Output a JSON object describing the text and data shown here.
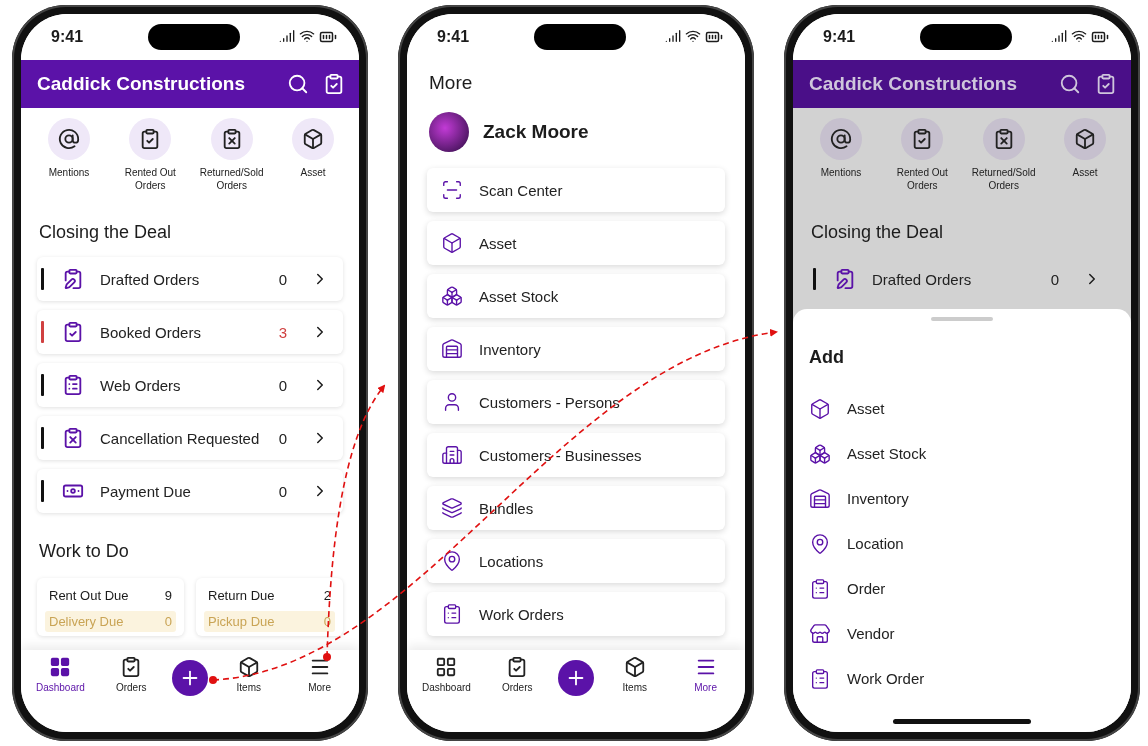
{
  "dashboard_screen": {
    "status_bar": {
      "time": "9:41"
    },
    "header": {
      "title": "Caddick Constructions"
    },
    "quick_links": [
      {
        "label": "Mentions"
      },
      {
        "label": "Rented Out Orders"
      },
      {
        "label": "Returned/Sold Orders"
      },
      {
        "label": "Asset"
      }
    ],
    "closing_the_deal": {
      "title": "Closing the Deal",
      "rows": [
        {
          "label": "Drafted Orders",
          "count": "0",
          "flagged": false
        },
        {
          "label": "Booked Orders",
          "count": "3",
          "flagged": true
        },
        {
          "label": "Web Orders",
          "count": "0",
          "flagged": false
        },
        {
          "label": "Cancellation Requested",
          "count": "0",
          "flagged": false
        },
        {
          "label": "Payment Due",
          "count": "0",
          "flagged": false
        }
      ]
    },
    "work_to_do": {
      "title": "Work to Do",
      "cards": [
        {
          "label": "Rent Out Due",
          "count": "9",
          "sub_label": "Delivery Due",
          "sub_count": "0"
        },
        {
          "label": "Return Due",
          "count": "2",
          "sub_label": "Pickup Due",
          "sub_count": "0"
        }
      ]
    },
    "tab_bar": [
      {
        "label": "Dashboard",
        "selected": true
      },
      {
        "label": "Orders",
        "selected": false
      },
      {
        "label": "Items",
        "selected": false
      },
      {
        "label": "More",
        "selected": false
      }
    ]
  },
  "more_screen": {
    "status_bar": {
      "time": "9:41"
    },
    "title": "More",
    "profile": {
      "name": "Zack Moore"
    },
    "menu": [
      {
        "label": "Scan Center"
      },
      {
        "label": "Asset"
      },
      {
        "label": "Asset Stock"
      },
      {
        "label": "Inventory"
      },
      {
        "label": "Customers - Persons"
      },
      {
        "label": "Customers - Businesses"
      },
      {
        "label": "Bundles"
      },
      {
        "label": "Locations"
      },
      {
        "label": "Work Orders"
      }
    ],
    "tab_bar": [
      {
        "label": "Dashboard",
        "selected": false
      },
      {
        "label": "Orders",
        "selected": false
      },
      {
        "label": "Items",
        "selected": false
      },
      {
        "label": "More",
        "selected": true
      }
    ]
  },
  "add_screen": {
    "status_bar": {
      "time": "9:41"
    },
    "header": {
      "title": "Caddick Constructions"
    },
    "quick_links": [
      {
        "label": "Mentions"
      },
      {
        "label": "Rented Out Orders"
      },
      {
        "label": "Returned/Sold Orders"
      },
      {
        "label": "Asset"
      }
    ],
    "closing_the_deal": {
      "title": "Closing the Deal",
      "rows": [
        {
          "label": "Drafted Orders",
          "count": "0",
          "flagged": false
        }
      ]
    },
    "sheet": {
      "title": "Add",
      "items": [
        {
          "label": "Asset"
        },
        {
          "label": "Asset Stock"
        },
        {
          "label": "Inventory"
        },
        {
          "label": "Location"
        },
        {
          "label": "Order"
        },
        {
          "label": "Vendor"
        },
        {
          "label": "Work Order"
        }
      ]
    }
  }
}
